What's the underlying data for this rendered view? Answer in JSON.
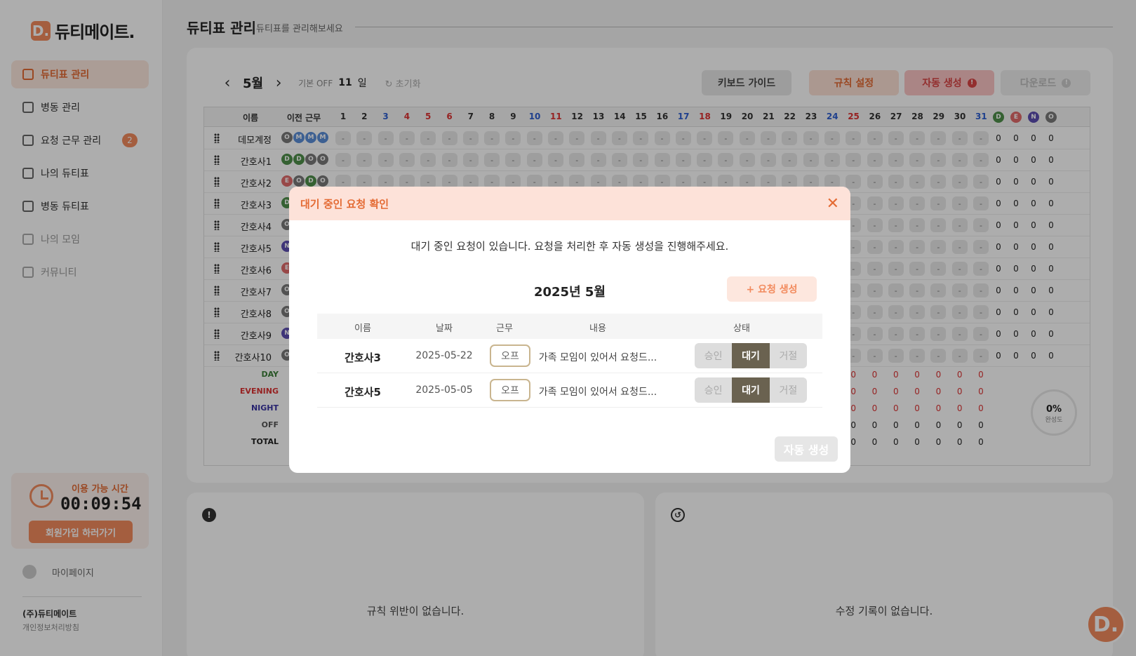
{
  "app": {
    "logo_mark": "D.",
    "logo_text": "듀티메이트."
  },
  "sidebar": {
    "items": [
      {
        "label": "듀티표 관리",
        "icon": "calendar-icon",
        "active": true
      },
      {
        "label": "병동 관리",
        "icon": "building-icon"
      },
      {
        "label": "요청 근무 관리",
        "icon": "request-icon",
        "badge": "2"
      },
      {
        "label": "나의 듀티표",
        "icon": "person-card-icon"
      },
      {
        "label": "병동 듀티표",
        "icon": "group-icon"
      },
      {
        "label": "나의 모임",
        "icon": "cup-icon",
        "dim": true
      },
      {
        "label": "커뮤니티",
        "icon": "chat-icon",
        "dim": true
      }
    ],
    "time_label": "이용 가능 시간",
    "time_value": "00:09:54",
    "signup_label": "회원가입 하러가기",
    "mypage_label": "마이페이지",
    "company": "(주)듀티메이트",
    "privacy": "개인정보처리방침"
  },
  "header": {
    "title": "듀티표 관리",
    "subtitle": "듀티표를 관리해보세요"
  },
  "toolbar": {
    "month": "5월",
    "off_label": "기본 OFF",
    "off_value": "11",
    "off_unit": "일",
    "reset_label": "초기화",
    "keyboard_label": "키보드 가이드",
    "rule_label": "규칙 설정",
    "auto_label": "자동 생성",
    "download_label": "다운로드"
  },
  "grid": {
    "header_name": "이름",
    "header_prev": "이전 근무",
    "days": [
      "1",
      "2",
      "3",
      "4",
      "5",
      "6",
      "7",
      "8",
      "9",
      "10",
      "11",
      "12",
      "13",
      "14",
      "15",
      "16",
      "17",
      "18",
      "19",
      "20",
      "21",
      "22",
      "23",
      "24",
      "25",
      "26",
      "27",
      "28",
      "29",
      "30",
      "31"
    ],
    "day_colors": {
      "3": "#2f5fd0",
      "4": "#d33",
      "5": "#d33",
      "6": "#d33",
      "10": "#2f5fd0",
      "11": "#d33",
      "17": "#2f5fd0",
      "18": "#d33",
      "24": "#2f5fd0",
      "25": "#d33",
      "31": "#2f5fd0"
    },
    "count_headers": [
      "D",
      "E",
      "N",
      "O"
    ],
    "shift_colors": {
      "D": "#4e8f4a",
      "E": "#e06a6a",
      "N": "#5c4db1",
      "O": "#7a7a7a",
      "M": "#5b8ed8"
    },
    "empty_mark": "-",
    "rows": [
      {
        "name": "데모계정",
        "prev": [
          "O",
          "M",
          "M",
          "M"
        ],
        "counts": [
          "0",
          "0",
          "0",
          "0"
        ]
      },
      {
        "name": "간호사1",
        "prev": [
          "D",
          "D",
          "O",
          "O"
        ],
        "counts": [
          "0",
          "0",
          "0",
          "0"
        ]
      },
      {
        "name": "간호사2",
        "prev": [
          "E",
          "O",
          "D",
          "O"
        ],
        "counts": [
          "0",
          "0",
          "0",
          "0"
        ]
      },
      {
        "name": "간호사3",
        "prev": [
          "D"
        ],
        "counts": [
          "0",
          "0",
          "0",
          "0"
        ]
      },
      {
        "name": "간호사4",
        "prev": [
          "O"
        ],
        "counts": [
          "0",
          "0",
          "0",
          "0"
        ]
      },
      {
        "name": "간호사5",
        "prev": [
          "N"
        ],
        "counts": [
          "0",
          "0",
          "0",
          "0"
        ]
      },
      {
        "name": "간호사6",
        "prev": [
          "E"
        ],
        "counts": [
          "0",
          "0",
          "0",
          "0"
        ]
      },
      {
        "name": "간호사7",
        "prev": [
          "O"
        ],
        "counts": [
          "0",
          "0",
          "0",
          "0"
        ]
      },
      {
        "name": "간호사8",
        "prev": [
          "O"
        ],
        "counts": [
          "0",
          "0",
          "0",
          "0"
        ]
      },
      {
        "name": "간호사9",
        "prev": [
          "N"
        ],
        "counts": [
          "0",
          "0",
          "0",
          "0"
        ]
      },
      {
        "name": "간호사10",
        "prev": [
          "O"
        ],
        "counts": [
          "0",
          "0",
          "0",
          "0"
        ]
      }
    ],
    "summary": [
      {
        "label": "DAY",
        "color": "#3c7f38"
      },
      {
        "label": "EVENING",
        "color": "#d33"
      },
      {
        "label": "NIGHT",
        "color": "#3a34a4"
      },
      {
        "label": "OFF",
        "color": "#555"
      },
      {
        "label": "TOTAL",
        "color": "#222"
      }
    ],
    "summary_value": "0",
    "progress_value": "0%",
    "progress_label": "완성도"
  },
  "panels": {
    "violations_msg": "규칙 위반이 없습니다.",
    "history_msg": "수정 기록이 없습니다."
  },
  "modal": {
    "title": "대기 중인 요청 확인",
    "message": "대기 중인 요청이 있습니다. 요청을 처리한 후 자동 생성을 진행해주세요.",
    "month": "2025년 5월",
    "new_request_label": "+ 요청 생성",
    "columns": [
      "이름",
      "날짜",
      "근무",
      "내용",
      "상태"
    ],
    "requests": [
      {
        "name": "간호사3",
        "date": "2025-05-22",
        "shift": "오프",
        "content": "가족 모임이 있어서 요청드..."
      },
      {
        "name": "간호사5",
        "date": "2025-05-05",
        "shift": "오프",
        "content": "가족 모임이 있어서 요청드..."
      }
    ],
    "status_options": [
      "승인",
      "대기",
      "거절"
    ],
    "status_selected": "대기",
    "auto_label": "자동 생성"
  },
  "fab": {
    "label": "D."
  }
}
